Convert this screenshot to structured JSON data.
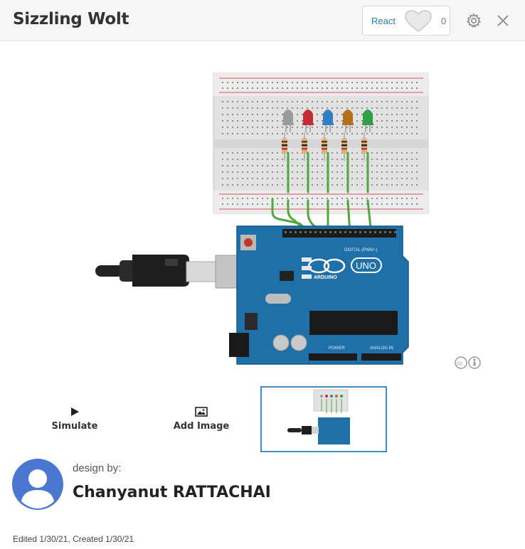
{
  "header": {
    "title": "Sizzling Wolt",
    "react_label": "React",
    "react_count": "0",
    "settings_icon": "gear-icon",
    "close_icon": "close-icon"
  },
  "circuit": {
    "led_colors": [
      "#9a9a9a",
      "#c42b32",
      "#2f7fc1",
      "#b3701d",
      "#2f9e45"
    ],
    "board_label": "UNO",
    "board_brand": "ARDUINO",
    "header_label": "DIGITAL (PWM~)",
    "power_label": "POWER",
    "analog_label": "ANALOG IN"
  },
  "license_badge": "cc-by-icon",
  "actions": {
    "simulate": {
      "label": "Simulate",
      "icon": "play-icon"
    },
    "add_image": {
      "label": "Add Image",
      "icon": "image-icon"
    }
  },
  "designer": {
    "prefix": "design by:",
    "name": "Chanyanut RATTACHAI",
    "avatar_icon": "user-avatar-icon"
  },
  "meta": {
    "dates": "Edited 1/30/21, Created 1/30/21"
  }
}
